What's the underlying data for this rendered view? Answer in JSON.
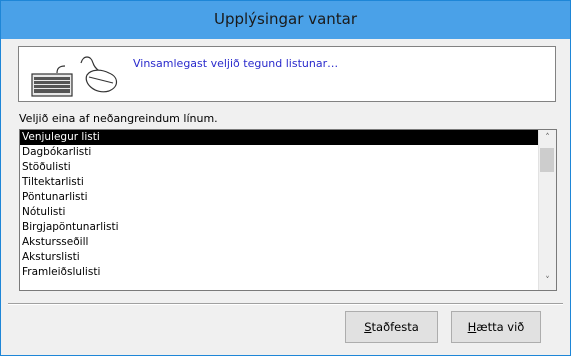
{
  "window": {
    "title": "Upplýsingar vantar"
  },
  "message": {
    "text": "Vinsamlegast veljið tegund listunar…",
    "keyboard_icon": "keyboard-icon",
    "mouse_icon": "mouse-icon",
    "text_color": "#2a2acc"
  },
  "prompt": {
    "label": "Veljið eina af neðangreindum línum."
  },
  "list": {
    "selected_index": 0,
    "items": [
      "Venjulegur listi",
      "Dagbókarlisti",
      "Stöðulisti",
      "Tiltektarlisti",
      "Pöntunarlisti",
      "Nótulisti",
      "Birgjapöntunarlisti",
      "Akstursseðill",
      "Aksturslisti",
      "Framleiðslulisti"
    ]
  },
  "buttons": {
    "ok_first": "S",
    "ok_rest": "taðfesta",
    "cancel_first": "H",
    "cancel_rest": "ætta við"
  },
  "colors": {
    "titlebar": "#4aa1e8",
    "window_border": "#1e86d7",
    "selection": "#000000"
  }
}
